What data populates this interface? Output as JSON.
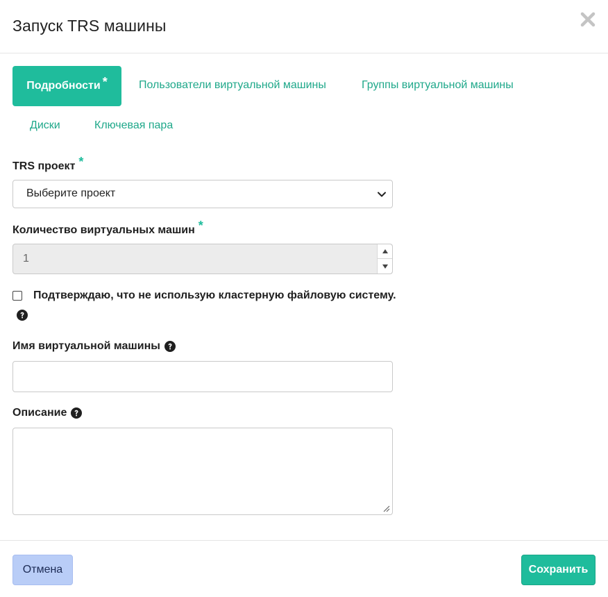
{
  "dialog": {
    "title": "Запуск TRS машины",
    "close_icon": "close-icon"
  },
  "tabs": [
    {
      "label": "Подробности",
      "required_mark": "*",
      "active": true
    },
    {
      "label": "Пользователи виртуальной машины",
      "active": false
    },
    {
      "label": "Группы виртуальной машины",
      "active": false
    },
    {
      "label": "Диски",
      "active": false
    },
    {
      "label": "Ключевая пара",
      "active": false
    }
  ],
  "form": {
    "project": {
      "label": "TRS проект",
      "required_mark": "*",
      "selected": "Выберите проект"
    },
    "vm_count": {
      "label": "Количество виртуальных машин",
      "required_mark": "*",
      "value": "1"
    },
    "confirm": {
      "text": "Подтверждаю, что не использую кластерную файловую систему.",
      "checked": false
    },
    "vm_name": {
      "label": "Имя виртуальной машины",
      "value": ""
    },
    "description": {
      "label": "Описание",
      "value": ""
    }
  },
  "footer": {
    "cancel_label": "Отмена",
    "save_label": "Сохранить"
  },
  "colors": {
    "accent": "#1fbc9c",
    "tab_text": "#1fa88a",
    "cancel_bg": "#b9cdf7"
  }
}
